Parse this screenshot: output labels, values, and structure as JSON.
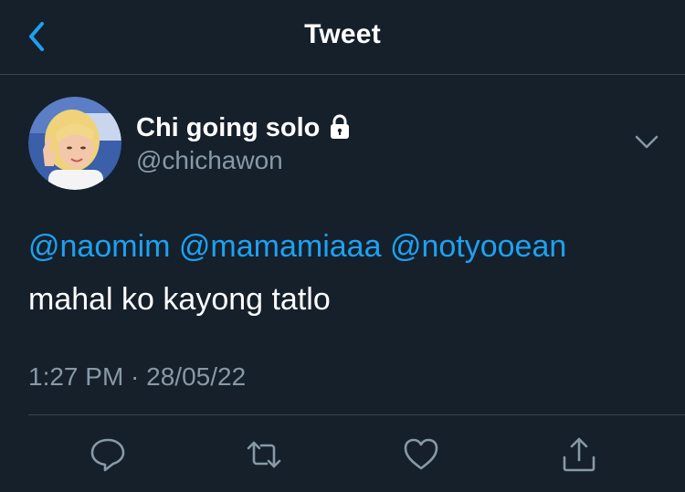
{
  "header": {
    "title": "Tweet",
    "back_icon": "chevron-left-icon"
  },
  "tweet": {
    "display_name": "Chi going solo",
    "handle": "@chichawon",
    "protected_icon": "lock-icon",
    "mentions": [
      "@naomim",
      "@mamamiaaa",
      "@notyooean"
    ],
    "text": "mahal ko kayong tatlo",
    "timestamp": "1:27 PM · 28/05/22"
  },
  "actions": [
    {
      "icon": "reply-icon"
    },
    {
      "icon": "retweet-icon"
    },
    {
      "icon": "like-icon"
    },
    {
      "icon": "share-icon"
    }
  ],
  "colors": {
    "background": "#15202b",
    "accent": "#1da1f2",
    "secondary_text": "#8899a6",
    "divider": "#38444d"
  }
}
